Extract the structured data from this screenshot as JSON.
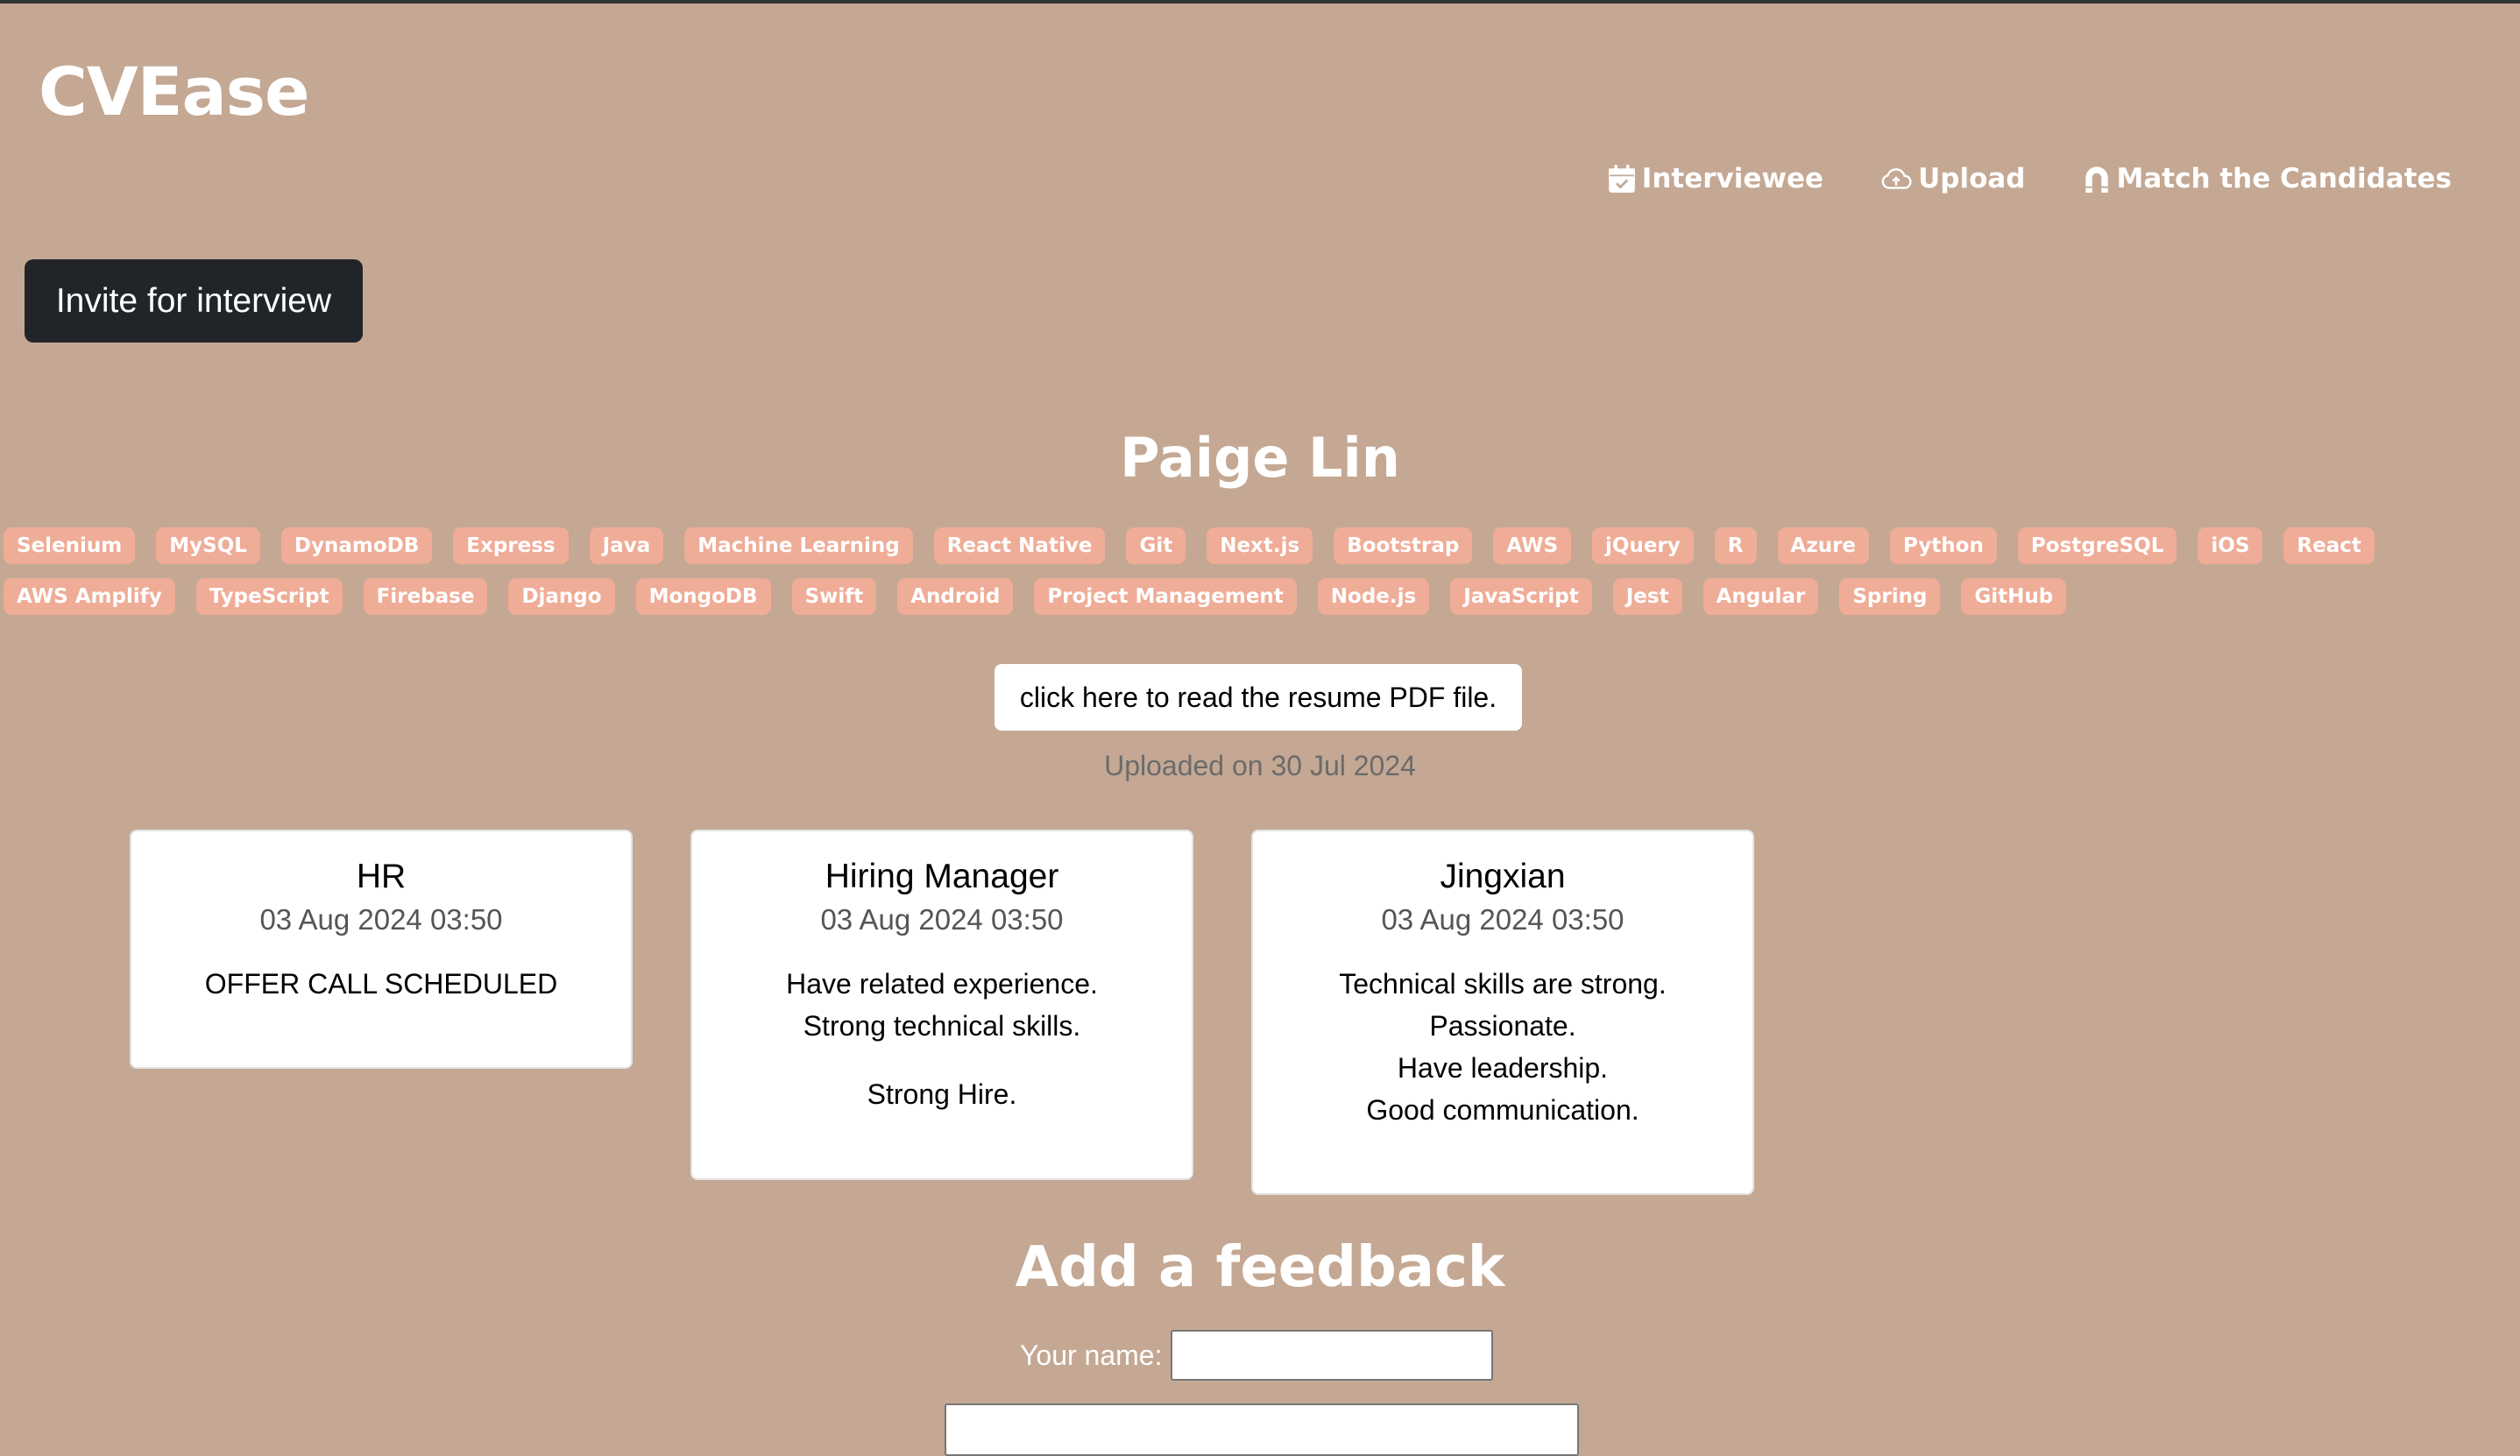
{
  "app": {
    "brand": "CVEase"
  },
  "nav": {
    "items": [
      {
        "label": "Interviewee",
        "icon": "calendar-check-icon"
      },
      {
        "label": "Upload",
        "icon": "cloud-upload-icon"
      },
      {
        "label": "Match the Candidates",
        "icon": "magnet-icon"
      }
    ]
  },
  "actions": {
    "invite_label": "Invite for interview"
  },
  "candidate": {
    "name": "Paige Lin",
    "skills": [
      "Selenium",
      "MySQL",
      "DynamoDB",
      "Express",
      "Java",
      "Machine Learning",
      "React Native",
      "Git",
      "Next.js",
      "Bootstrap",
      "AWS",
      "jQuery",
      "R",
      "Azure",
      "Python",
      "PostgreSQL",
      "iOS",
      "React",
      "AWS Amplify",
      "TypeScript",
      "Firebase",
      "Django",
      "MongoDB",
      "Swift",
      "Android",
      "Project Management",
      "Node.js",
      "JavaScript",
      "Jest",
      "Angular",
      "Spring",
      "GitHub"
    ],
    "resume_label": "click here to read the resume PDF file.",
    "uploaded_text": "Uploaded on 30 Jul 2024"
  },
  "feedback_cards": [
    {
      "author": "HR",
      "date": "03 Aug 2024 03:50",
      "paragraphs": [
        [
          "OFFER CALL SCHEDULED"
        ]
      ]
    },
    {
      "author": "Hiring Manager",
      "date": "03 Aug 2024 03:50",
      "paragraphs": [
        [
          "Have related experience.",
          "Strong technical skills."
        ],
        [
          "Strong Hire."
        ]
      ]
    },
    {
      "author": "Jingxian",
      "date": "03 Aug 2024 03:50",
      "paragraphs": [
        [
          "Technical skills are strong.",
          "Passionate.",
          "Have leadership.",
          "Good communication."
        ]
      ]
    }
  ],
  "feedback_form": {
    "title": "Add a feedback",
    "name_label": "Your name:",
    "name_value": "",
    "feedback_value": ""
  },
  "colors": {
    "background": "#c4a893",
    "skill_badge": "#efac97",
    "dark_button": "#212529",
    "top_border": "#2f3437"
  }
}
